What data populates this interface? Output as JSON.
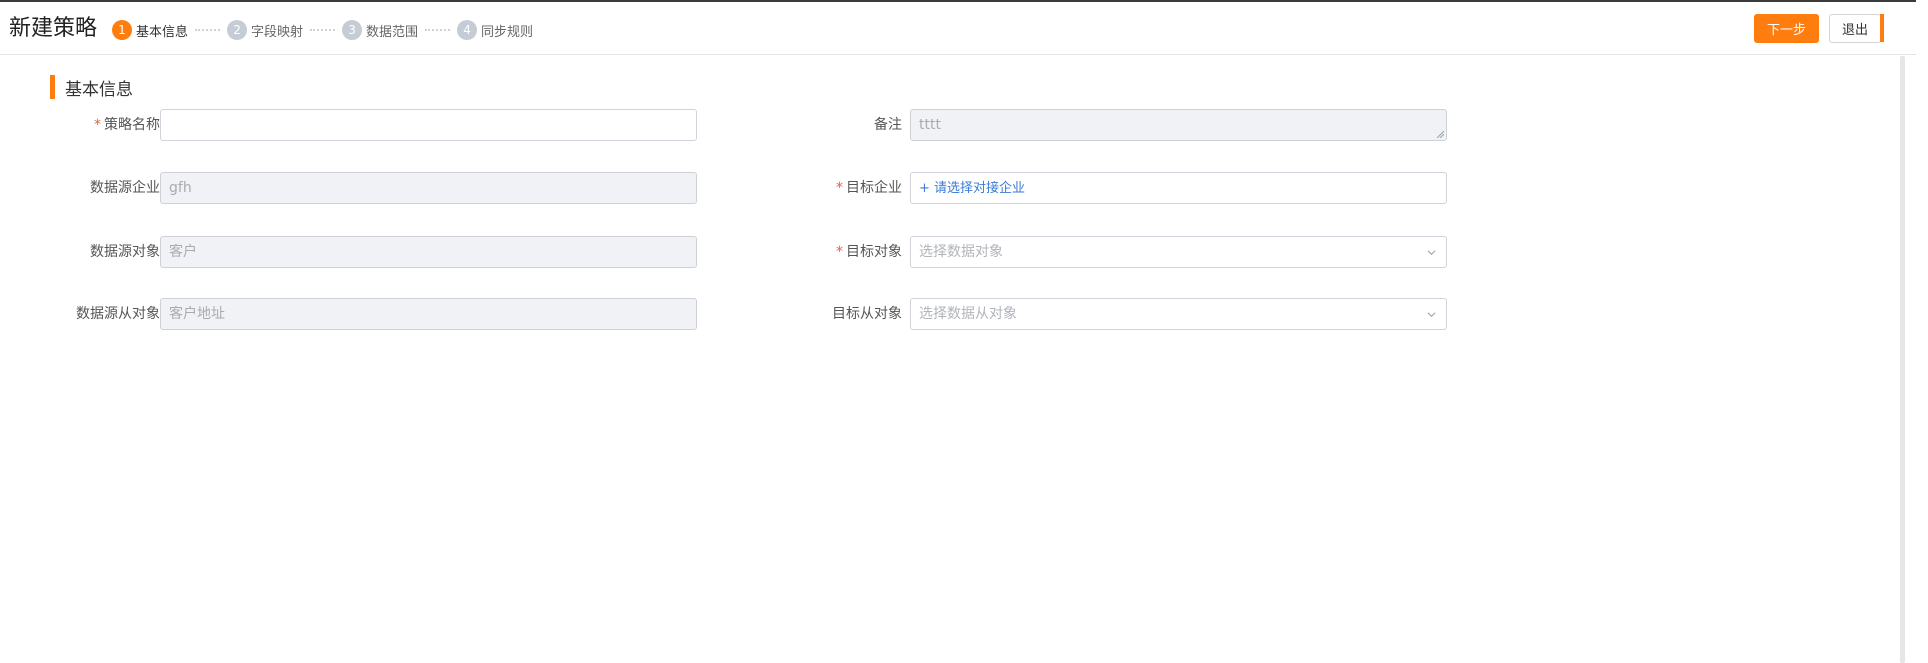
{
  "header": {
    "title": "新建策略",
    "steps": [
      {
        "num": "1",
        "label": "基本信息"
      },
      {
        "num": "2",
        "label": "字段映射"
      },
      {
        "num": "3",
        "label": "数据范围"
      },
      {
        "num": "4",
        "label": "同步规则"
      }
    ],
    "active_step": 1,
    "next_label": "下一步",
    "exit_label": "退出"
  },
  "colors": {
    "accent": "#ff7d0f",
    "required": "#f25a3b",
    "link": "#3a7bd5"
  },
  "section": {
    "title": "基本信息"
  },
  "form": {
    "strategy_name": {
      "required_mark": "*",
      "label": "策略名称",
      "value": ""
    },
    "remark": {
      "label": "备注",
      "value": "tttt"
    },
    "source_company": {
      "label": "数据源企业",
      "value": "gfh"
    },
    "target_company": {
      "required_mark": "*",
      "label": "目标企业",
      "link": "+ 请选择对接企业"
    },
    "source_object": {
      "label": "数据源对象",
      "value": "客户"
    },
    "target_object": {
      "required_mark": "*",
      "label": "目标对象",
      "placeholder": "选择数据对象"
    },
    "source_sub_object": {
      "label": "数据源从对象",
      "value": "客户地址"
    },
    "target_sub_object": {
      "label": "目标从对象",
      "placeholder": "选择数据从对象"
    }
  },
  "icons": {
    "select_arrow": "chevron-down-icon",
    "resize": "resize-grip-icon"
  }
}
